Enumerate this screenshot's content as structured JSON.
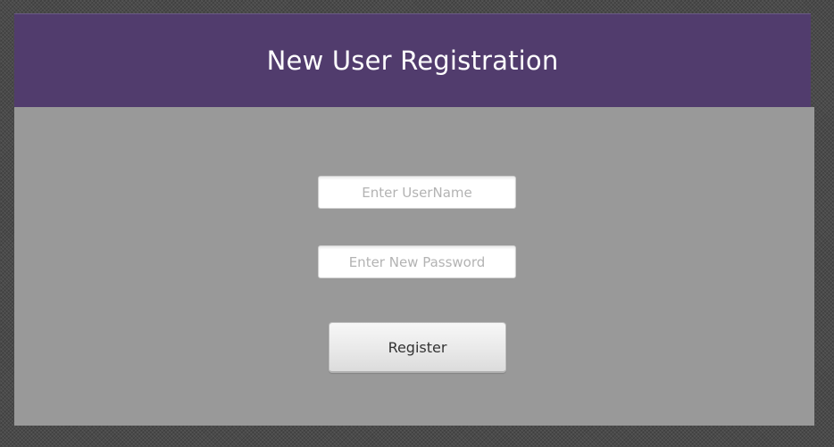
{
  "header": {
    "title": "New User Registration"
  },
  "form": {
    "username": {
      "value": "",
      "placeholder": "Enter UserName"
    },
    "password": {
      "value": "",
      "placeholder": "Enter New Password"
    },
    "register_label": "Register"
  },
  "colors": {
    "header_background": "#513c6d",
    "panel_background": "#999999",
    "page_background": "#4a4a4a"
  }
}
